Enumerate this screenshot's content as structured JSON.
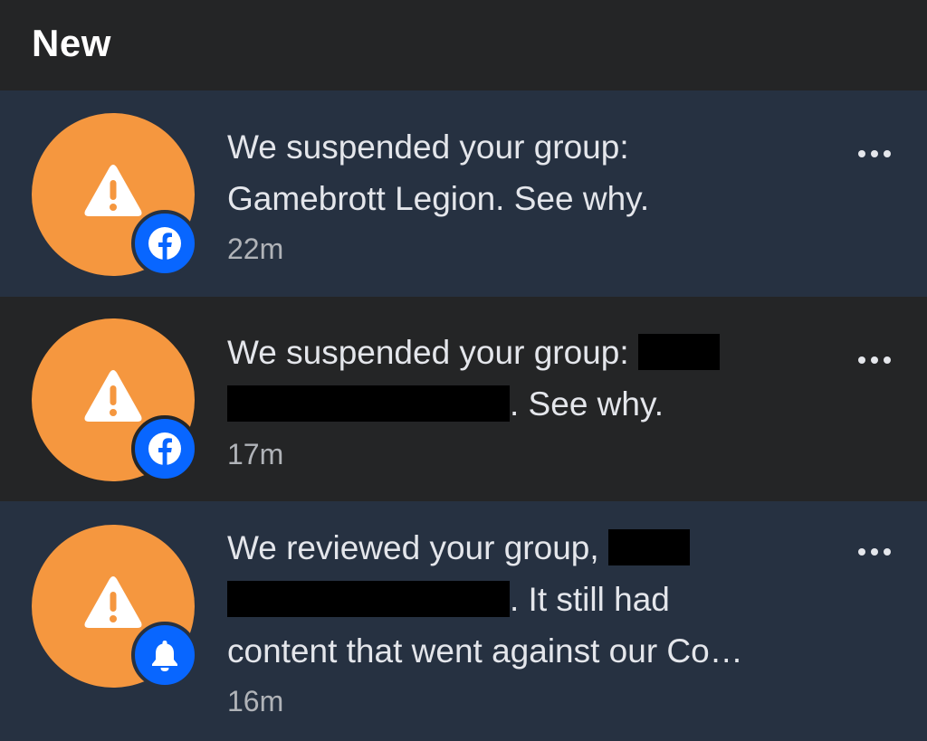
{
  "section": {
    "title": "New"
  },
  "colors": {
    "unread_bg": "#263141",
    "read_bg": "#242526",
    "avatar": "#f5973f",
    "badge": "#0866ff",
    "text": "#e4e6eb",
    "time": "#b0b3b8"
  },
  "notifications": [
    {
      "icon": "warning-icon",
      "badge_icon": "facebook-icon",
      "line1": "We suspended your group:",
      "line2": "Gamebrott Legion. See why.",
      "time": "22m",
      "unread": true
    },
    {
      "icon": "warning-icon",
      "badge_icon": "facebook-icon",
      "line1": "We suspended your group:",
      "line2_suffix": ". See why.",
      "time": "17m",
      "unread": false,
      "redacted": true
    },
    {
      "icon": "warning-icon",
      "badge_icon": "bell-icon",
      "line1": "We reviewed your group,",
      "line2_suffix": ". It still had",
      "line3": "content that went against our Co…",
      "time": "16m",
      "unread": true,
      "redacted": true
    }
  ]
}
